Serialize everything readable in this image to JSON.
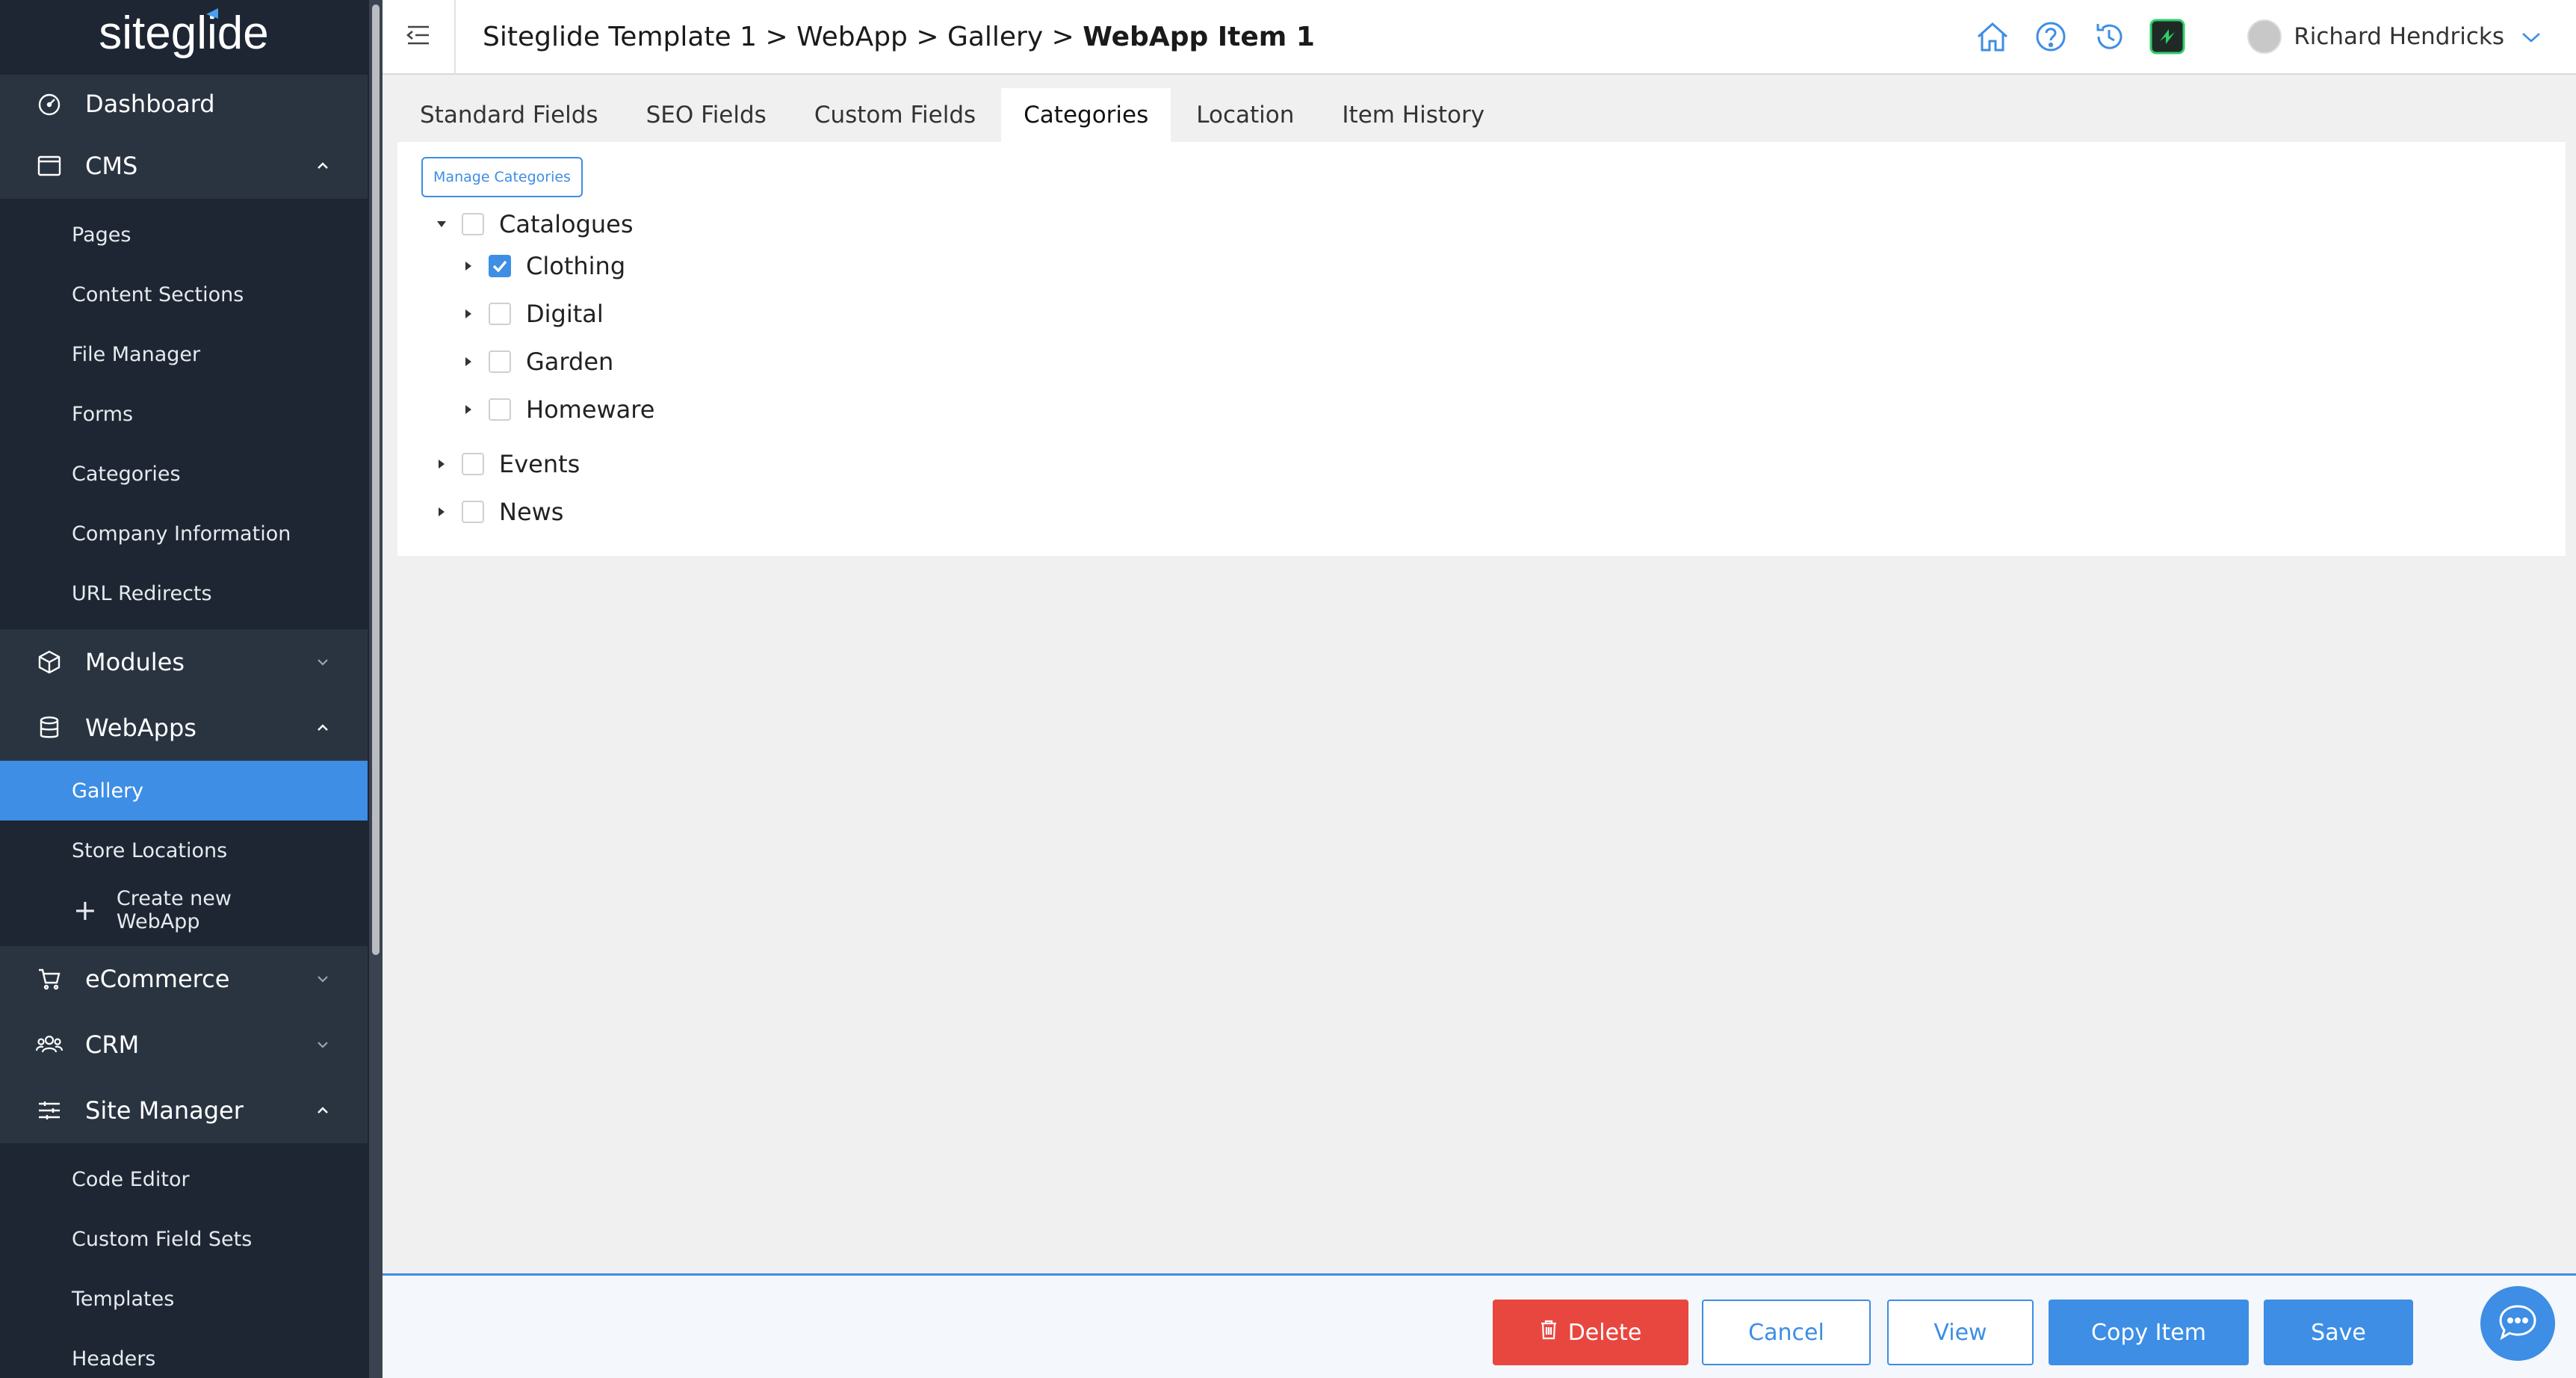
{
  "brand": {
    "logo_text": "siteglide",
    "accent": "#3d8ee4",
    "sidebar_bg": "#1d2632"
  },
  "sidebar": {
    "sections": [
      {
        "label": "Dashboard",
        "icon": "gauge-icon"
      },
      {
        "label": "CMS",
        "icon": "browser-window-icon",
        "expanded": true,
        "items": [
          "Pages",
          "Content Sections",
          "File Manager",
          "Forms",
          "Categories",
          "Company Information",
          "URL Redirects"
        ]
      },
      {
        "label": "Modules",
        "icon": "cube-icon",
        "expanded": false
      },
      {
        "label": "WebApps",
        "icon": "database-icon",
        "expanded": true,
        "items": [
          "Gallery",
          "Store Locations"
        ],
        "create_label": "Create new WebApp",
        "active": "Gallery"
      },
      {
        "label": "eCommerce",
        "icon": "cart-icon",
        "expanded": false
      },
      {
        "label": "CRM",
        "icon": "users-icon",
        "expanded": false
      },
      {
        "label": "Site Manager",
        "icon": "sliders-icon",
        "expanded": true,
        "items": [
          "Code Editor",
          "Custom Field Sets",
          "Templates",
          "Headers"
        ]
      }
    ]
  },
  "header": {
    "breadcrumb_path": "Siteglide Template 1 > WebApp > Gallery > ",
    "breadcrumb_current": "WebApp Item 1",
    "user_name": "Richard Hendricks"
  },
  "tabs": [
    "Standard Fields",
    "SEO Fields",
    "Custom Fields",
    "Categories",
    "Location",
    "Item History"
  ],
  "active_tab": "Categories",
  "panel": {
    "manage_label": "Manage Categories",
    "tree": [
      {
        "label": "Catalogues",
        "checked": false,
        "expanded": true,
        "children": [
          {
            "label": "Clothing",
            "checked": true
          },
          {
            "label": "Digital",
            "checked": false
          },
          {
            "label": "Garden",
            "checked": false
          },
          {
            "label": "Homeware",
            "checked": false
          }
        ]
      },
      {
        "label": "Events",
        "checked": false,
        "expanded": false
      },
      {
        "label": "News",
        "checked": false,
        "expanded": false
      }
    ]
  },
  "footer": {
    "delete_label": "Delete",
    "cancel_label": "Cancel",
    "view_label": "View",
    "copy_label": "Copy Item",
    "save_label": "Save"
  }
}
